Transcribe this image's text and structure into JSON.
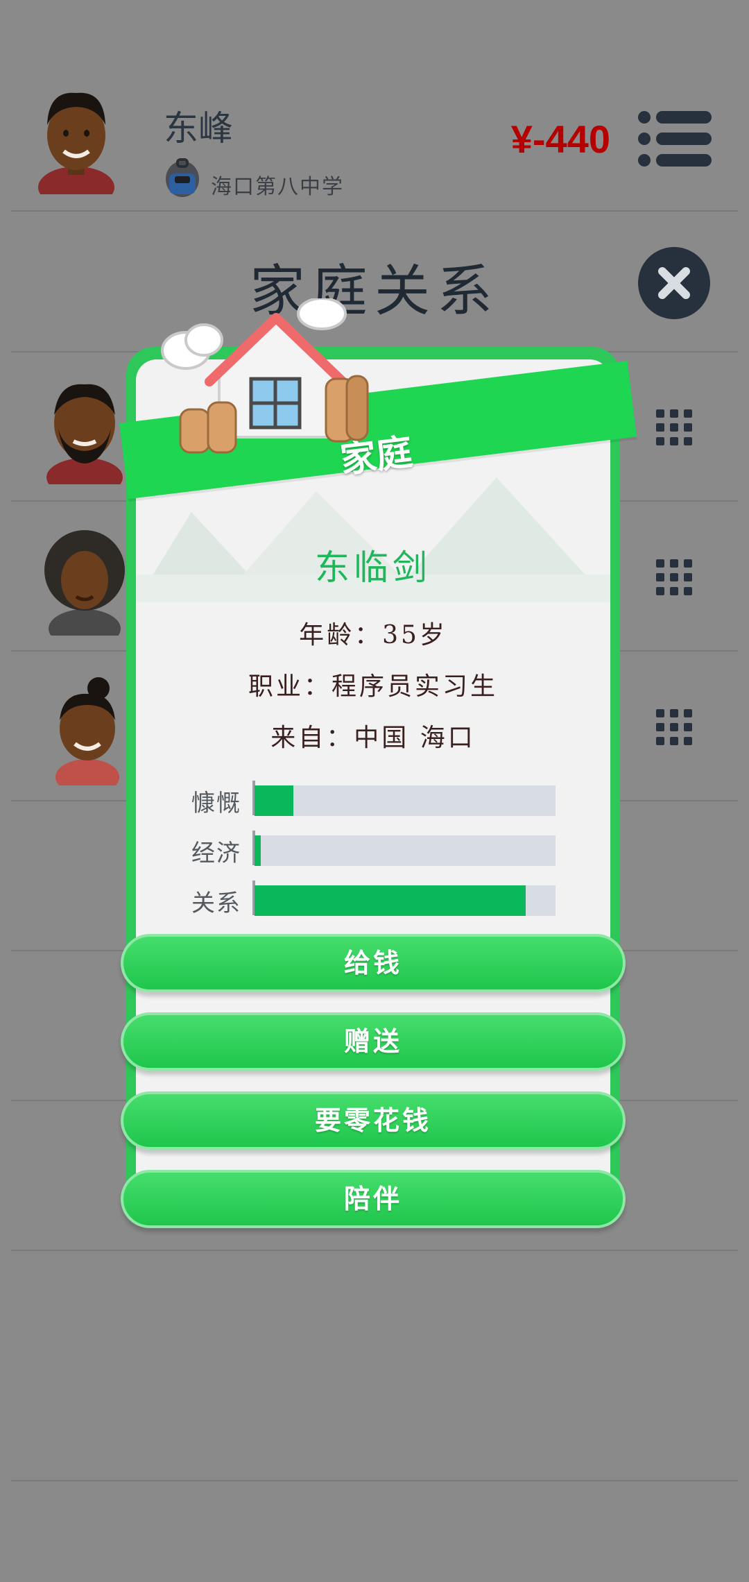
{
  "header": {
    "player_name": "东峰",
    "school": "海口第八中学",
    "money": "¥-440"
  },
  "page": {
    "title": "家庭关系"
  },
  "icons": {
    "menu": "menu-icon",
    "close": "close-icon",
    "grid": "grid-icon",
    "school": "backpack-icon",
    "house": "house-icon"
  },
  "modal": {
    "banner": "家庭",
    "member_name": "东临剑",
    "age_line": "年龄：35岁",
    "job_line": "职业：程序员实习生",
    "from_line": "来自：中国 海口",
    "stats": [
      {
        "label": "慷慨",
        "value": 0.13
      },
      {
        "label": "经济",
        "value": 0.02
      },
      {
        "label": "关系",
        "value": 0.9
      }
    ],
    "buttons": [
      {
        "label": "给钱"
      },
      {
        "label": "赠送"
      },
      {
        "label": "要零花钱"
      },
      {
        "label": "陪伴"
      }
    ]
  },
  "colors": {
    "money": "#b40000",
    "accent_green": "#1fd652",
    "name_green": "#20b65b",
    "bar_fill": "#0bb75b"
  }
}
